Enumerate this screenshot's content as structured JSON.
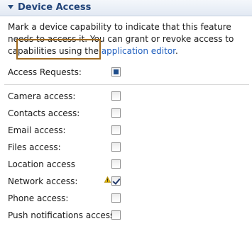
{
  "section": {
    "title": "Device Access",
    "description_before": "Mark a device capability to indicate that this feature needs to access it. You can grant or revoke access to capabilities using the ",
    "link_text": "application editor",
    "description_after": "."
  },
  "access_requests": {
    "label": "Access Requests:",
    "state": "partial"
  },
  "capabilities": [
    {
      "label": "Camera access:",
      "checked": false
    },
    {
      "label": "Contacts access:",
      "checked": false
    },
    {
      "label": "Email access:",
      "checked": false
    },
    {
      "label": "Files access:",
      "checked": false
    },
    {
      "label": "Location access",
      "checked": false
    },
    {
      "label": "Network access:",
      "checked": true,
      "warning": true
    },
    {
      "label": "Phone access:",
      "checked": false
    },
    {
      "label": "Push notifications access:",
      "checked": false
    }
  ],
  "icons": {
    "twistie": "chevron-down-icon",
    "warning": "warning-icon"
  },
  "colors": {
    "header_text": "#22457a",
    "link": "#1f5fbf",
    "callout_border": "#a06a1f",
    "warning": "#e0b400"
  }
}
